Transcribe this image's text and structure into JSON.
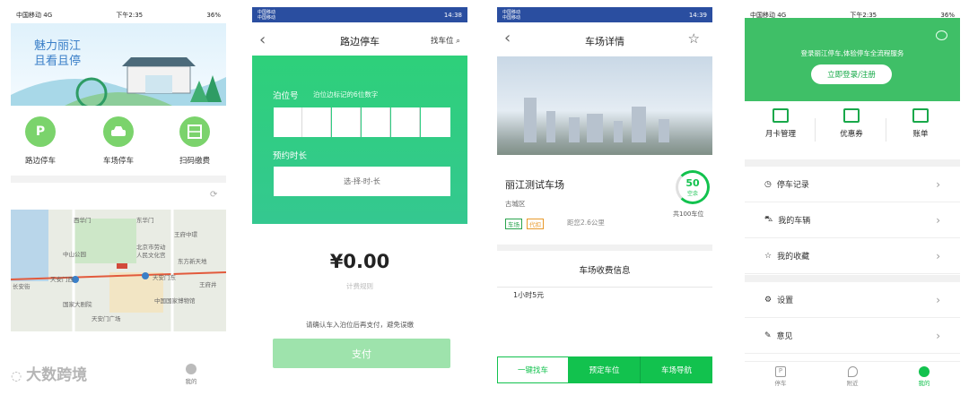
{
  "watermark": "大数跨境",
  "screen1": {
    "status": {
      "carrier": "中国移动",
      "network": "4G",
      "time": "下午2:35",
      "battery": "36%"
    },
    "banner": {
      "line1": "魅力丽江",
      "line2": "且看且停"
    },
    "actions": [
      {
        "label": "路边停车",
        "icon": "parking-icon"
      },
      {
        "label": "车场停车",
        "icon": "car-icon"
      },
      {
        "label": "扫码缴费",
        "icon": "scan-icon"
      }
    ],
    "map_labels": [
      "西华门",
      "东华门",
      "王府中環",
      "北京市劳动",
      "人民文化宫",
      "中山公园",
      "东方新天地",
      "天安门东",
      "王府井",
      "长安街",
      "天安门西",
      "中国国家博物馆",
      "国家大剧院",
      "天安门广场"
    ],
    "tab_me": "我的"
  },
  "screen2": {
    "status": {
      "carrier1": "中国移动",
      "carrier2": "中国移动",
      "time": "14:38"
    },
    "title": "路边停车",
    "find_spot": "找车位",
    "berth_label": "泊位号",
    "berth_hint": "泊位边标记的6位数字",
    "duration_label": "预约时长",
    "duration_placeholder": "选-择-时-长",
    "amount": "¥0.00",
    "rule_link": "计费规则",
    "confirm_text": "请确认车入泊位后再支付，避免误缴",
    "pay_button": "支付"
  },
  "screen3": {
    "status": {
      "carrier1": "中国移动",
      "carrier2": "中国移动",
      "time": "14:39"
    },
    "title": "车场详情",
    "lot_name": "丽江测试车场",
    "district": "古城区",
    "tags": [
      "车场",
      "代扣"
    ],
    "distance": "距您2.6公里",
    "vacant_count": "50",
    "vacant_label": "空余",
    "total": "共100车位",
    "fee_title": "车场收费信息",
    "fee_rule": "1小时5元",
    "buttons": [
      "一键找车",
      "预定车位",
      "车场导航"
    ]
  },
  "screen4": {
    "status": {
      "carrier": "中国移动",
      "network": "4G",
      "time": "下午2:35",
      "battery": "36%"
    },
    "login_hint": "登录丽江停车,体验停车全流程服务",
    "login_button": "立即登录/注册",
    "quick": [
      {
        "label": "月卡管理",
        "icon": "monthly-card-icon"
      },
      {
        "label": "优惠券",
        "icon": "coupon-icon"
      },
      {
        "label": "账单",
        "icon": "bill-icon"
      }
    ],
    "menu1": [
      {
        "label": "停车记录",
        "icon": "clock-icon"
      },
      {
        "label": "我的车辆",
        "icon": "car-icon"
      },
      {
        "label": "我的收藏",
        "icon": "star-icon"
      }
    ],
    "menu2": [
      {
        "label": "设置",
        "icon": "gear-icon"
      },
      {
        "label": "意见",
        "icon": "pen-icon"
      }
    ],
    "tabs": [
      "停车",
      "附近",
      "我的"
    ]
  }
}
